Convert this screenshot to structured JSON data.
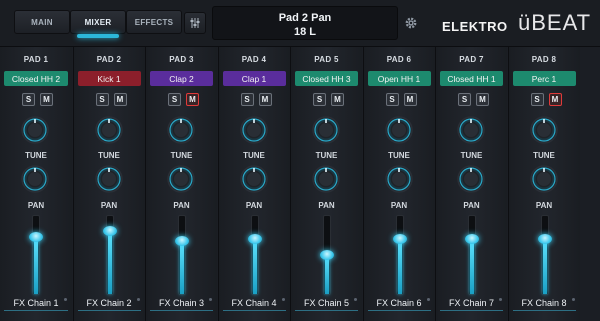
{
  "top": {
    "tabs": [
      {
        "label": "MAIN",
        "active": false
      },
      {
        "label": "MIXER",
        "active": true
      },
      {
        "label": "EFFECTS",
        "active": false
      }
    ],
    "display_line1": "Pad 2 Pan",
    "display_line2": "18 L",
    "logo_brand": "ELEKTRO",
    "logo_product": "üBEAT",
    "icons": {
      "settings": "sliders-icon",
      "gear": "gear-icon"
    }
  },
  "colors": {
    "accent": "#2cb7d9",
    "mute_on": "#e03a3a",
    "green": "#1d8a6e",
    "red": "#8c1f2b",
    "purple": "#5a2d9c"
  },
  "labels": {
    "tune": "TUNE",
    "pan": "PAN",
    "solo": "S",
    "mute": "M"
  },
  "pads": [
    {
      "title": "PAD 1",
      "name": "Closed HH 2",
      "color": "#1d8a6e",
      "mute_on": false,
      "level": 0.72,
      "fx": "FX Chain 1"
    },
    {
      "title": "PAD 2",
      "name": "Kick 1",
      "color": "#8c1f2b",
      "mute_on": false,
      "level": 0.8,
      "fx": "FX Chain 2"
    },
    {
      "title": "PAD 3",
      "name": "Clap 2",
      "color": "#5a2d9c",
      "mute_on": true,
      "level": 0.68,
      "fx": "FX Chain 3"
    },
    {
      "title": "PAD 4",
      "name": "Clap 1",
      "color": "#5a2d9c",
      "mute_on": false,
      "level": 0.7,
      "fx": "FX Chain 4"
    },
    {
      "title": "PAD 5",
      "name": "Closed HH 3",
      "color": "#1d8a6e",
      "mute_on": false,
      "level": 0.5,
      "fx": "FX Chain 5"
    },
    {
      "title": "PAD 6",
      "name": "Open HH 1",
      "color": "#1d8a6e",
      "mute_on": false,
      "level": 0.7,
      "fx": "FX Chain 6"
    },
    {
      "title": "PAD 7",
      "name": "Closed HH 1",
      "color": "#1d8a6e",
      "mute_on": false,
      "level": 0.7,
      "fx": "FX Chain 7"
    },
    {
      "title": "PAD 8",
      "name": "Perc 1",
      "color": "#1d8a6e",
      "mute_on": true,
      "level": 0.7,
      "fx": "FX Chain 8"
    }
  ]
}
